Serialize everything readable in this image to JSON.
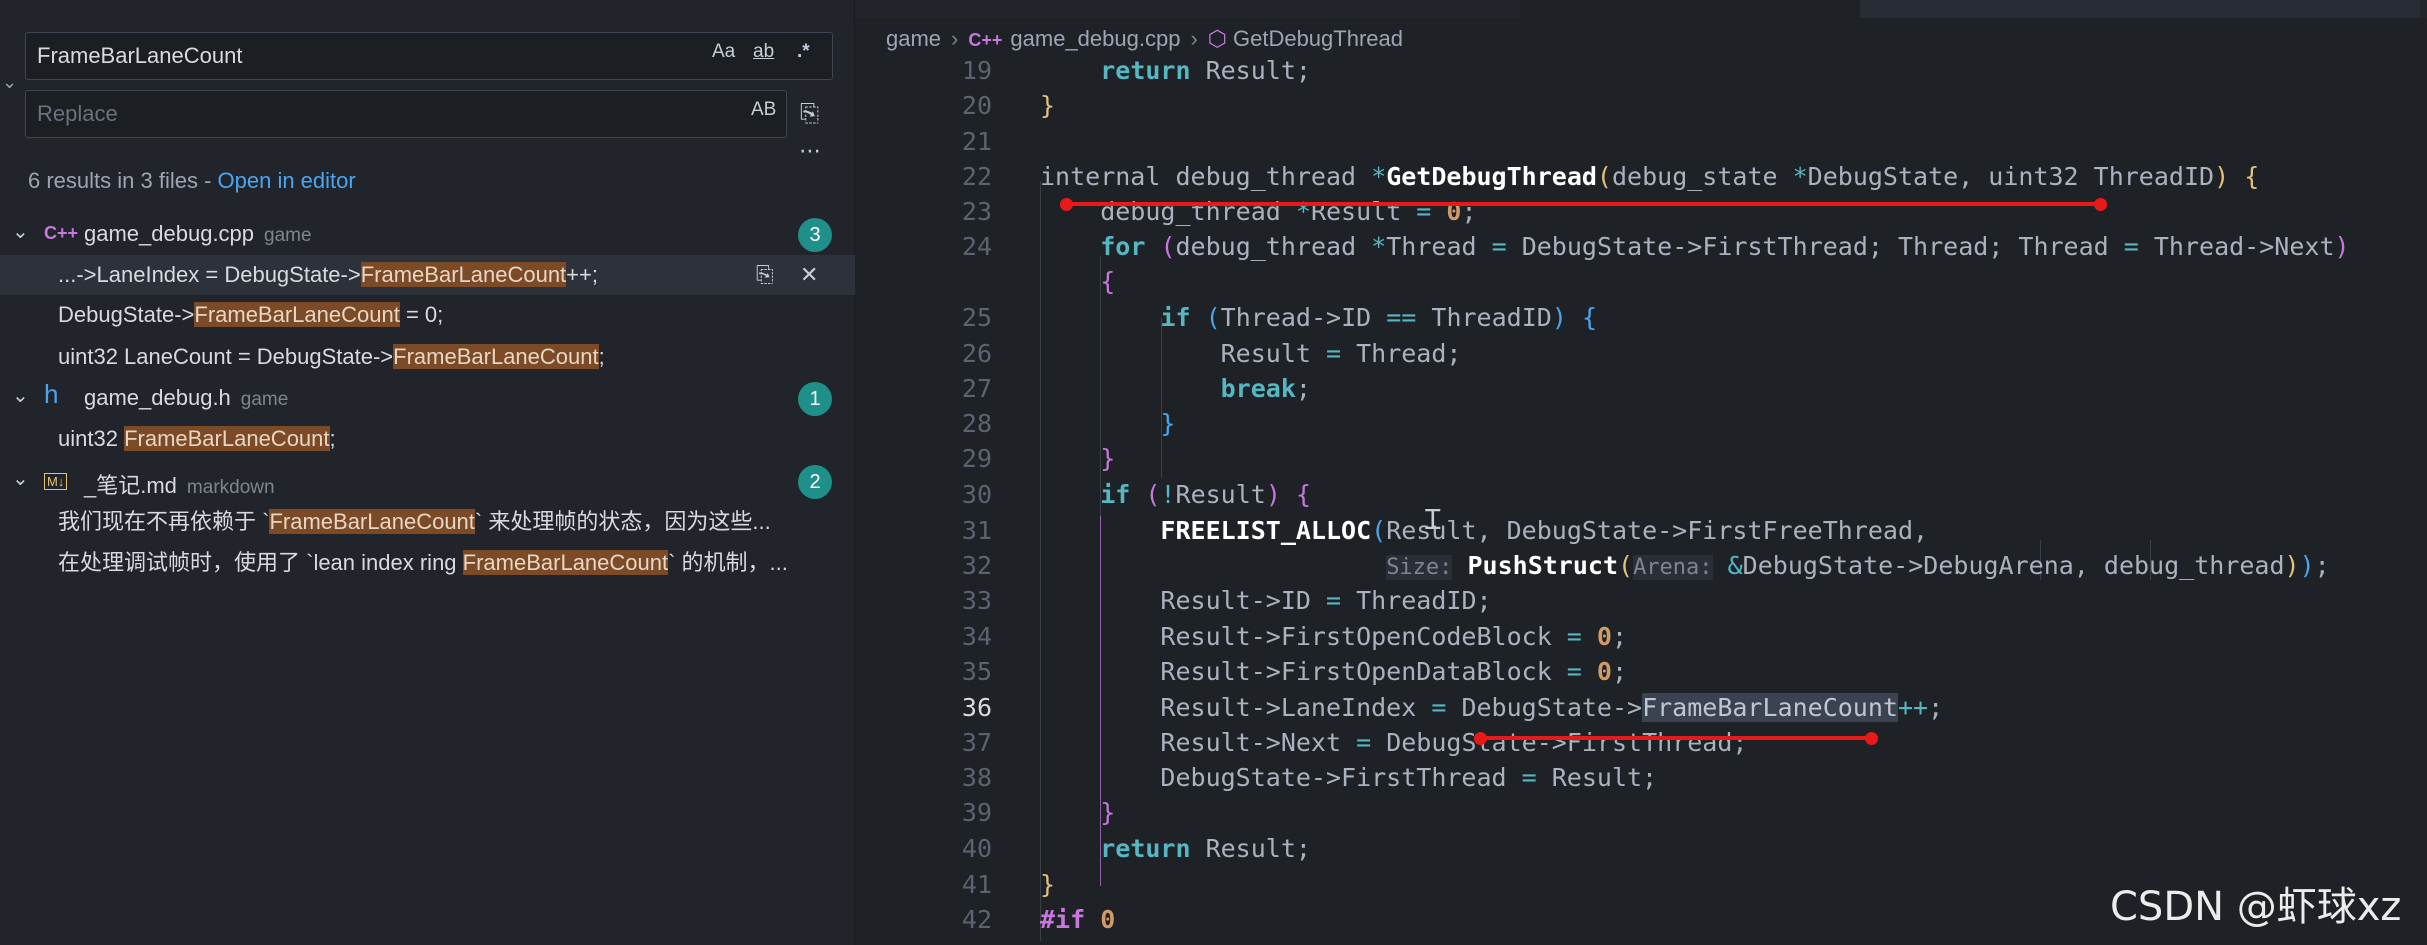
{
  "search": {
    "find_value": "FrameBarLaneCount",
    "replace_placeholder": "Replace",
    "opt_case": "Aa",
    "opt_word": "ab",
    "opt_regex": ".*",
    "opt_preserve_case": "AB",
    "summary_prefix": "6 results in 3 files - ",
    "open_in_editor": "Open in editor"
  },
  "results": [
    {
      "file": "game_debug.cpp",
      "folder": "game",
      "icon": "cpp-file-icon",
      "count": "3",
      "matches": [
        {
          "before": "...->LaneIndex = DebugState->",
          "match": "FrameBarLaneCount",
          "after": "++;"
        },
        {
          "before": "DebugState->",
          "match": "FrameBarLaneCount",
          "after": " = 0;"
        },
        {
          "before": "uint32 LaneCount = DebugState->",
          "match": "FrameBarLaneCount",
          "after": ";"
        }
      ]
    },
    {
      "file": "game_debug.h",
      "folder": "game",
      "icon": "header-file-icon",
      "count": "1",
      "matches": [
        {
          "before": "uint32 ",
          "match": "FrameBarLaneCount",
          "after": ";"
        }
      ]
    },
    {
      "file": "_笔记.md",
      "folder": "markdown",
      "icon": "markdown-file-icon",
      "count": "2",
      "matches": [
        {
          "before": "我们现在不再依赖于 `",
          "match": "FrameBarLaneCount",
          "after": "` 来处理帧的状态，因为这些..."
        },
        {
          "before": "在处理调试帧时，使用了 `lean index ring ",
          "match": "FrameBarLaneCount",
          "after": "` 的机制，..."
        }
      ]
    }
  ],
  "breadcrumb": {
    "folder": "game",
    "file": "game_debug.cpp",
    "file_icon": "C++",
    "symbol": "GetDebugThread"
  },
  "line_numbers": [
    "19",
    "20",
    "21",
    "22",
    "23",
    "24",
    "",
    "25",
    "26",
    "27",
    "28",
    "29",
    "30",
    "31",
    "32",
    "33",
    "34",
    "35",
    "36",
    "37",
    "38",
    "39",
    "40",
    "41",
    "42"
  ],
  "current_line": "36",
  "watermark": "CSDN @虾球xz",
  "colors": {
    "accent": "#4aa5f0",
    "badge": "#1f8f8a",
    "search_highlight": "#7b4a26",
    "red_annotation": "#e81919"
  }
}
